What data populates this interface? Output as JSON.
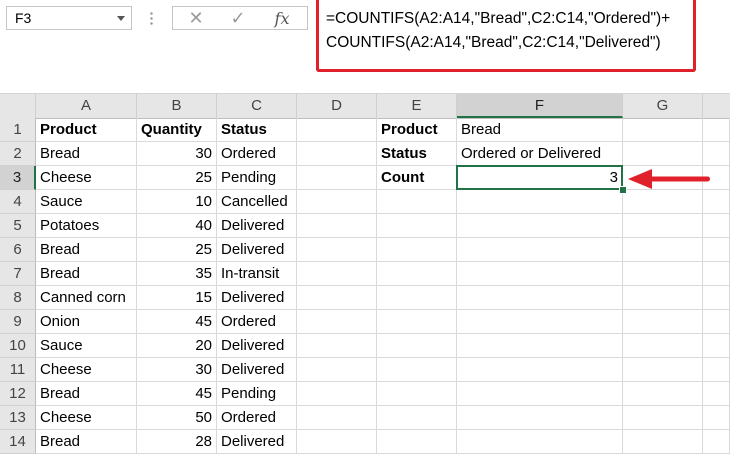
{
  "name_box": {
    "value": "F3"
  },
  "formula_bar": {
    "cancel_symbol": "✕",
    "enter_symbol": "✓",
    "fx_label": "fx",
    "line1": "=COUNTIFS(A2:A14,\"Bread\",C2:C14,\"Ordered\")+",
    "line2": "COUNTIFS(A2:A14,\"Bread\",C2:C14,\"Delivered\")"
  },
  "columns": [
    "A",
    "B",
    "C",
    "D",
    "E",
    "F",
    "G"
  ],
  "active_column": "F",
  "active_row": 3,
  "rows": [
    {
      "num": "1",
      "A": "Product",
      "B": "Quantity",
      "C": "Status",
      "E": "Product",
      "F": "Bread"
    },
    {
      "num": "2",
      "A": "Bread",
      "B": "30",
      "C": "Ordered",
      "E": "Status",
      "F": "Ordered or Delivered"
    },
    {
      "num": "3",
      "A": "Cheese",
      "B": "25",
      "C": "Pending",
      "E": "Count",
      "F": "3"
    },
    {
      "num": "4",
      "A": "Sauce",
      "B": "10",
      "C": "Cancelled"
    },
    {
      "num": "5",
      "A": "Potatoes",
      "B": "40",
      "C": "Delivered"
    },
    {
      "num": "6",
      "A": "Bread",
      "B": "25",
      "C": "Delivered"
    },
    {
      "num": "7",
      "A": "Bread",
      "B": "35",
      "C": "In-transit"
    },
    {
      "num": "8",
      "A": "Canned corn",
      "B": "15",
      "C": "Delivered"
    },
    {
      "num": "9",
      "A": "Onion",
      "B": "45",
      "C": "Ordered"
    },
    {
      "num": "10",
      "A": "Sauce",
      "B": "20",
      "C": "Delivered"
    },
    {
      "num": "11",
      "A": "Cheese",
      "B": "30",
      "C": "Delivered"
    },
    {
      "num": "12",
      "A": "Bread",
      "B": "45",
      "C": "Pending"
    },
    {
      "num": "13",
      "A": "Cheese",
      "B": "50",
      "C": "Ordered"
    },
    {
      "num": "14",
      "A": "Bread",
      "B": "28",
      "C": "Delivered"
    }
  ],
  "colors": {
    "highlight_red": "#e0202a",
    "excel_green": "#217346",
    "header_gray": "#e6e6e6"
  }
}
